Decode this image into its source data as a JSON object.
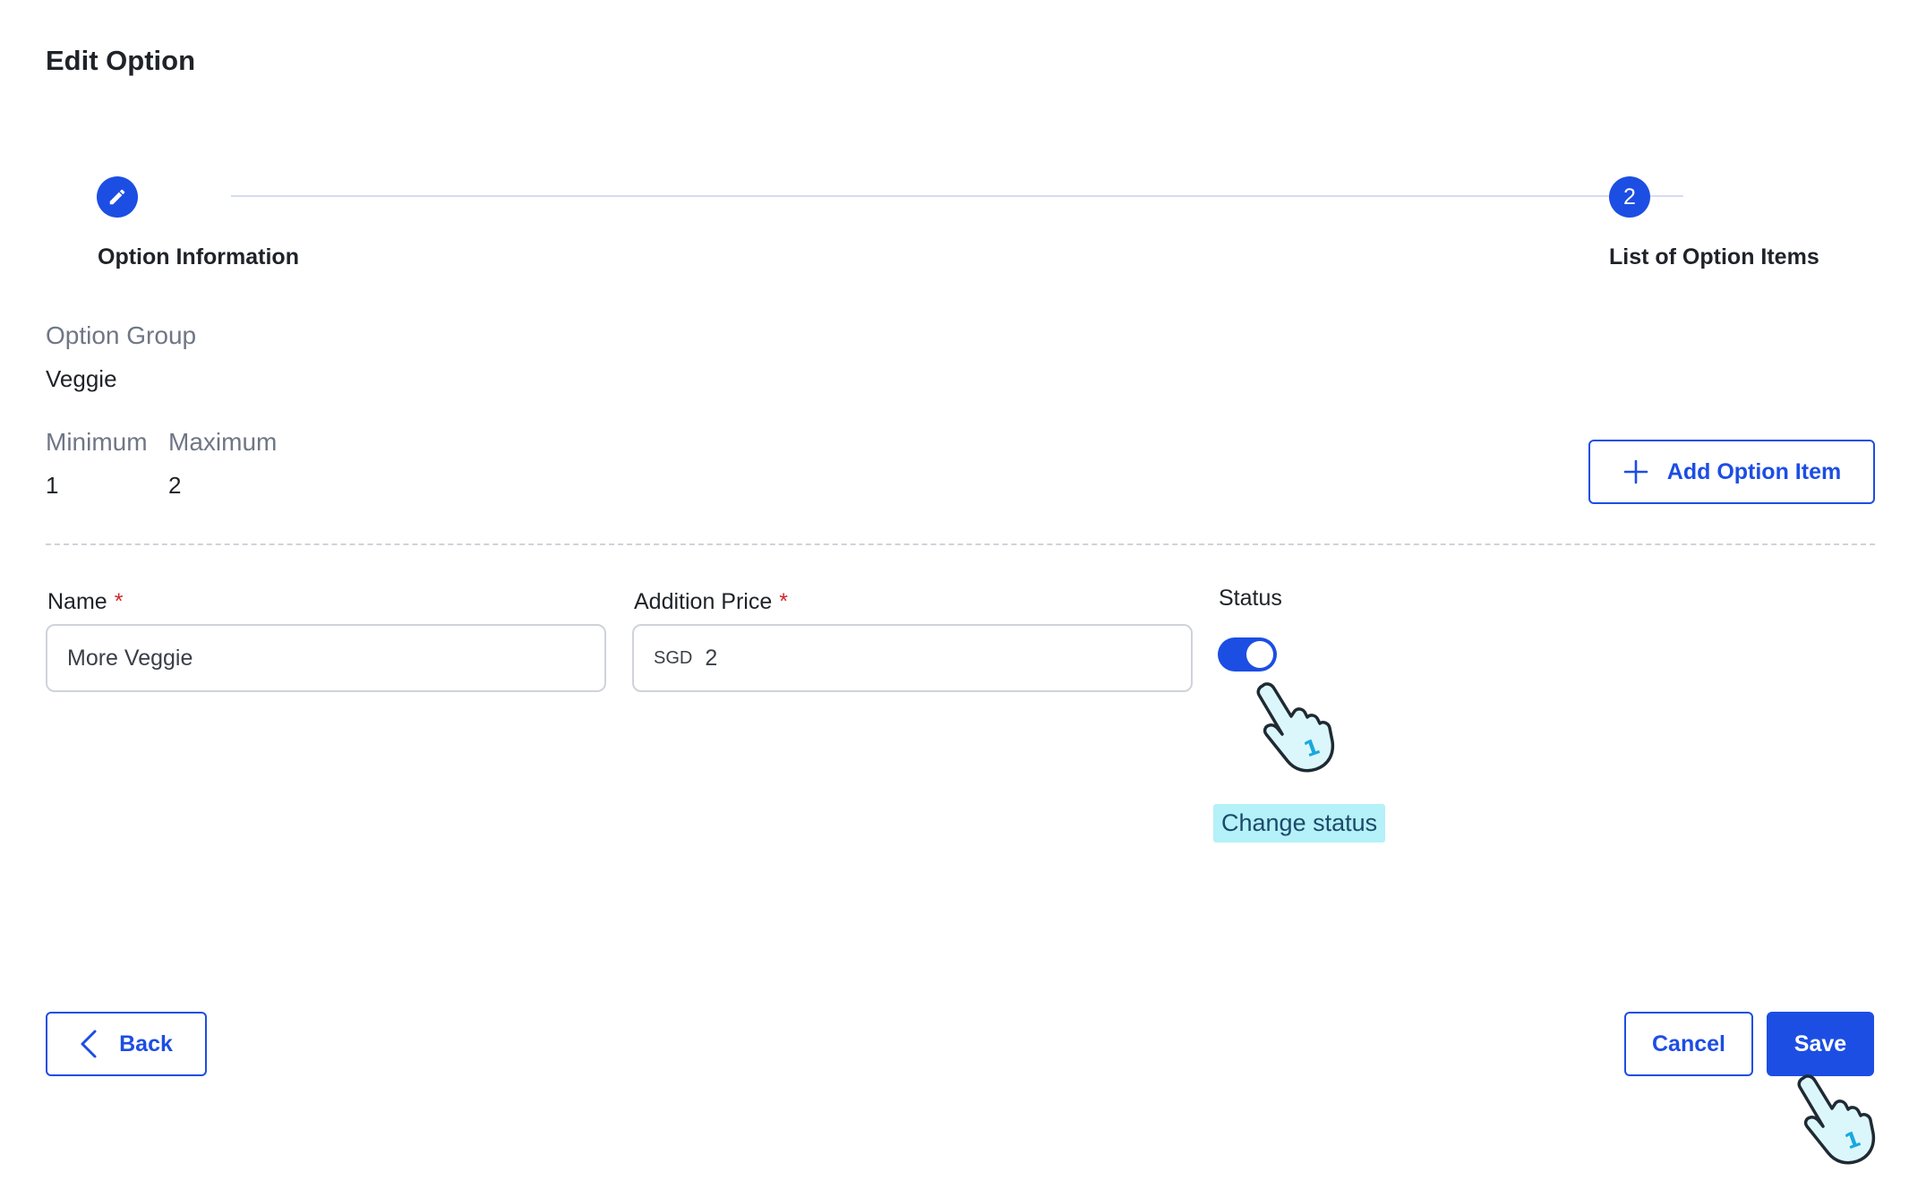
{
  "page": {
    "title": "Edit Option"
  },
  "stepper": {
    "steps": [
      {
        "label": "Option Information",
        "icon": "pencil-icon"
      },
      {
        "label": "List of Option Items",
        "number": "2"
      }
    ],
    "accent": "#1c4ee4"
  },
  "info": {
    "group_label": "Option Group",
    "group_value": "Veggie",
    "min_label": "Minimum",
    "min_value": "1",
    "max_label": "Maximum",
    "max_value": "2"
  },
  "toolbar": {
    "add_label": "Add Option Item",
    "add_icon": "plus-icon"
  },
  "form": {
    "name_label": "Name",
    "name_value": "More Veggie",
    "price_label": "Addition Price",
    "price_currency": "SGD",
    "price_value": "2",
    "required_mark": "*",
    "status_label": "Status",
    "status_on": true
  },
  "hint": {
    "text": "Change status"
  },
  "footer": {
    "back_label": "Back",
    "cancel_label": "Cancel",
    "save_label": "Save"
  },
  "cursor_badge": "1",
  "colors": {
    "primary": "#1c4ee4",
    "required": "#d4242b",
    "hint_bg": "#b5f1f8"
  }
}
